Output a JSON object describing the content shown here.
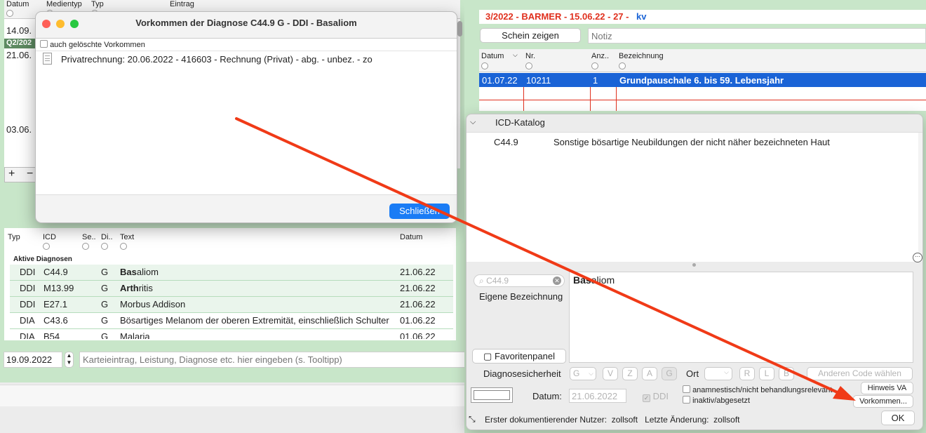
{
  "left_table": {
    "headers": [
      "Datum",
      "Medientyp",
      "Typ",
      "Eintrag"
    ],
    "dates": [
      "14.09.",
      "21.06.",
      "03.06."
    ],
    "quarter_label": "Q2/202"
  },
  "modal": {
    "title": "Vorkommen der Diagnose C44.9 G - DDI - Basaliom",
    "checkbox_label": "auch gelöschte Vorkommen",
    "item": "Privatrechnung: 20.06.2022 - 416603 - Rechnung (Privat) - abg. - unbez. - zo",
    "close_button": "Schließen"
  },
  "diag_table": {
    "headers": [
      "Typ",
      "ICD",
      "Se..",
      "Di..",
      "Text",
      "Datum"
    ],
    "section": "Aktive Diagnosen",
    "rows": [
      {
        "typ": "DDI",
        "icd": "C44.9",
        "si": "G",
        "text_bold": "Bas",
        "text_rest": "aliom",
        "datum": "21.06.22"
      },
      {
        "typ": "DDI",
        "icd": "M13.99",
        "si": "G",
        "text_bold": "Arth",
        "text_rest": "ritis",
        "datum": "21.06.22"
      },
      {
        "typ": "DDI",
        "icd": "E27.1",
        "si": "G",
        "text_bold": "",
        "text_rest": "Morbus Addison",
        "datum": "21.06.22"
      },
      {
        "typ": "DIA",
        "icd": "C43.6",
        "si": "G",
        "text_bold": "",
        "text_rest": "Bösartiges Melanom der oberen Extremität, einschließlich Schulter",
        "datum": "01.06.22"
      },
      {
        "typ": "DIA",
        "icd": "B54",
        "si": "G",
        "text_bold": "",
        "text_rest": "Malaria",
        "datum": "01.06.22"
      }
    ]
  },
  "bottom_input": {
    "date": "19.09.2022",
    "placeholder": "Karteieintrag, Leistung, Diagnose etc. hier eingeben (s. Tooltipp)"
  },
  "right": {
    "schein_title": "3/2022 - BARMER - 15.06.22 - 27 -",
    "schein_suffix": "kv",
    "schein_button": "Schein zeigen",
    "notiz_placeholder": "Notiz",
    "headers": [
      "Datum",
      "Nr.",
      "Anz..",
      "Bezeichnung"
    ],
    "row": {
      "datum": "01.07.22",
      "nr": "10211",
      "anz": "1",
      "bez": "Grundpauschale 6. bis 59. Lebensjahr"
    }
  },
  "icd_panel": {
    "title": "ICD-Katalog",
    "code": "C44.9",
    "desc": "Sonstige bösartige Neubildungen der nicht näher bezeichneten Haut",
    "search_value": "C44.9",
    "eigene": "Eigene Bezeichnung",
    "bezeichnung_bold": "Bas",
    "bezeichnung_rest": "aliom",
    "favoriten": "Favoritenpanel",
    "diagnosesicherheit": "Diagnosesicherheit",
    "g_select": "G",
    "letters_si": [
      "V",
      "Z",
      "A",
      "G"
    ],
    "ort": "Ort",
    "letters_ort": [
      "R",
      "L",
      "B"
    ],
    "anderen_code": "Anderen Code wählen",
    "datum_label": "Datum:",
    "datum_value": "21.06.2022",
    "ddi": "DDI",
    "chk1": "anamnestisch/nicht behandlungsrelevant",
    "chk2": "inaktiv/abgesetzt",
    "hinweis": "Hinweis VA",
    "vorkommen": "Vorkommen...",
    "footer": "Erster dokumentierender Nutzer:  zollsoft   Letzte Änderung:  zollsoft",
    "ok": "OK"
  }
}
